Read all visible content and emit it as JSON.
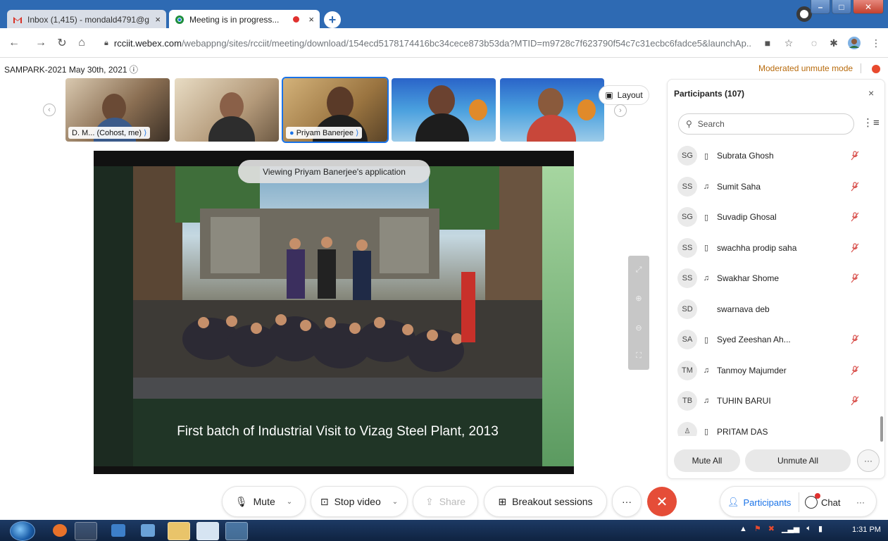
{
  "browser": {
    "tabs": [
      {
        "title": "Inbox (1,415) - mondald4791@g",
        "close": "×"
      },
      {
        "title": "Meeting is in progress...",
        "close": "×"
      }
    ],
    "new_tab": "+",
    "url_host": "rcciit.webex.com",
    "url_path": "/webappng/sites/rcciit/meeting/download/154ecd5178174416bc34cece873b53da?MTID=m9728c7f623790f54c7c31ecbc6fadce5&launchAp...",
    "window_buttons": [
      "–",
      "□",
      "✕"
    ]
  },
  "meeting": {
    "title": "SAMPARK-2021 May 30th, 2021",
    "moderated_label": "Moderated unmute mode",
    "layout_label": "Layout",
    "thumbnails": [
      {
        "name": "D. M...",
        "role": "(Cohost, me)"
      },
      {
        "name": ""
      },
      {
        "name": "Priyam Banerjee"
      },
      {
        "name": ""
      },
      {
        "name": ""
      }
    ],
    "viewing_label": "Viewing Priyam Banerjee's application",
    "slide_caption": "First batch of Industrial Visit to Vizag Steel Plant, 2013"
  },
  "participants": {
    "title": "Participants (107)",
    "close": "×",
    "search_placeholder": "Search",
    "list": [
      {
        "initials": "SG",
        "device": "▯",
        "name": "Subrata Ghosh",
        "muted": true
      },
      {
        "initials": "SS",
        "device": "♫",
        "name": "Sumit Saha",
        "muted": true
      },
      {
        "initials": "SG",
        "device": "▯",
        "name": "Suvadip Ghosal",
        "muted": true
      },
      {
        "initials": "SS",
        "device": "▯",
        "name": "swachha prodip saha",
        "muted": true
      },
      {
        "initials": "SS",
        "device": "♫",
        "name": "Swakhar Shome",
        "muted": true
      },
      {
        "initials": "SD",
        "device": "",
        "name": "swarnava deb",
        "muted": false
      },
      {
        "initials": "SA",
        "device": "▯",
        "name": "Syed Zeeshan Ah...",
        "muted": true
      },
      {
        "initials": "TM",
        "device": "♫",
        "name": "Tanmoy Majumder",
        "muted": true
      },
      {
        "initials": "TB",
        "device": "♫",
        "name": "TUHIN BARUI",
        "muted": true
      },
      {
        "initials": "",
        "device": "▯",
        "name": "PRITAM DAS",
        "muted": false
      }
    ],
    "mute_all": "Mute All",
    "unmute_all": "Unmute All",
    "more": "···"
  },
  "controls": {
    "mute": "Mute",
    "stop_video": "Stop video",
    "share": "Share",
    "breakout": "Breakout sessions",
    "more": "···",
    "end": "✕",
    "participants": "Participants",
    "chat": "Chat",
    "right_more": "···"
  },
  "taskbar": {
    "clock": "1:31 PM"
  },
  "colors": {
    "accent": "#1a73e8",
    "end_call": "#e54d38",
    "moderated": "#b86b0d",
    "tab_strip": "#2e6ab3"
  }
}
